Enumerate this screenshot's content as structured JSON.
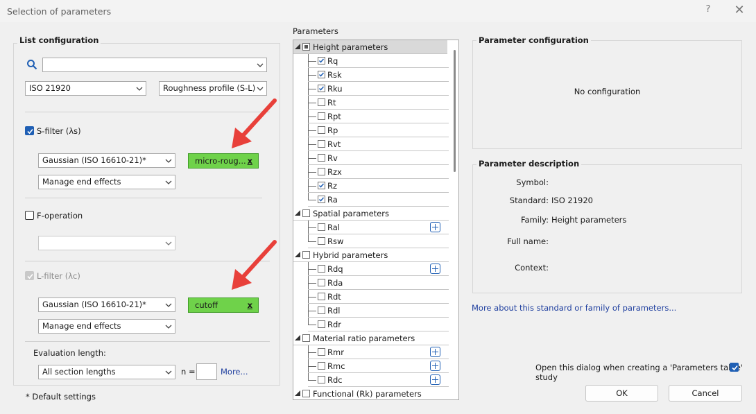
{
  "window": {
    "title": "Selection of parameters",
    "help": "?",
    "close": "✕"
  },
  "list_config": {
    "legend": "List configuration",
    "search": {
      "value": "",
      "placeholder": ""
    },
    "standard": "ISO 21920",
    "profile": "Roughness profile (S-L)",
    "s_filter": {
      "label": "S-filter (λs)",
      "checked": true,
      "type": "Gaussian (ISO 16610-21)*",
      "end_effects": "Manage end effects",
      "button": "micro-roug...",
      "button_x": "x"
    },
    "f_operation": {
      "label": "F-operation",
      "checked": false,
      "value": ""
    },
    "l_filter": {
      "label": "L-filter (λc)",
      "checked": true,
      "disabled": true,
      "type": "Gaussian (ISO 16610-21)*",
      "end_effects": "Manage end effects",
      "button": "cutoff",
      "button_x": "x"
    },
    "evaluation": {
      "label": "Evaluation length:",
      "value": "All section lengths",
      "n_label": "n =",
      "n_value": "",
      "more_link": "More..."
    }
  },
  "default_note": "* Default settings",
  "parameters": {
    "header": "Parameters",
    "groups": [
      {
        "name": "Height parameters",
        "state": "partial",
        "selected": true,
        "items": [
          {
            "name": "Rq",
            "checked": true,
            "plus": false
          },
          {
            "name": "Rsk",
            "checked": true,
            "plus": false
          },
          {
            "name": "Rku",
            "checked": true,
            "plus": false
          },
          {
            "name": "Rt",
            "checked": false,
            "plus": false
          },
          {
            "name": "Rpt",
            "checked": false,
            "plus": false
          },
          {
            "name": "Rp",
            "checked": false,
            "plus": false
          },
          {
            "name": "Rvt",
            "checked": false,
            "plus": false
          },
          {
            "name": "Rv",
            "checked": false,
            "plus": false
          },
          {
            "name": "Rzx",
            "checked": false,
            "plus": false
          },
          {
            "name": "Rz",
            "checked": true,
            "plus": false
          },
          {
            "name": "Ra",
            "checked": true,
            "plus": false
          }
        ]
      },
      {
        "name": "Spatial parameters",
        "state": "unchecked",
        "selected": false,
        "items": [
          {
            "name": "Ral",
            "checked": false,
            "plus": true
          },
          {
            "name": "Rsw",
            "checked": false,
            "plus": false
          }
        ]
      },
      {
        "name": "Hybrid parameters",
        "state": "unchecked",
        "selected": false,
        "items": [
          {
            "name": "Rdq",
            "checked": false,
            "plus": true
          },
          {
            "name": "Rda",
            "checked": false,
            "plus": false
          },
          {
            "name": "Rdt",
            "checked": false,
            "plus": false
          },
          {
            "name": "Rdl",
            "checked": false,
            "plus": false
          },
          {
            "name": "Rdr",
            "checked": false,
            "plus": false
          }
        ]
      },
      {
        "name": "Material ratio parameters",
        "state": "unchecked",
        "selected": false,
        "items": [
          {
            "name": "Rmr",
            "checked": false,
            "plus": true
          },
          {
            "name": "Rmc",
            "checked": false,
            "plus": true
          },
          {
            "name": "Rdc",
            "checked": false,
            "plus": true
          }
        ]
      },
      {
        "name": "Functional (Rk) parameters",
        "state": "unchecked",
        "selected": false,
        "items": []
      }
    ]
  },
  "param_config": {
    "legend": "Parameter configuration",
    "text": "No configuration"
  },
  "param_desc": {
    "legend": "Parameter description",
    "symbol_label": "Symbol:",
    "symbol": "",
    "standard_label": "Standard:",
    "standard": "ISO 21920",
    "family_label": "Family:",
    "family": "Height parameters",
    "fullname_label": "Full name:",
    "fullname": "",
    "context_label": "Context:",
    "context": ""
  },
  "more_link": "More about this standard or family of parameters...",
  "open_dialog": {
    "label": "Open this dialog when creating a 'Parameters table' study",
    "checked": true
  },
  "buttons": {
    "ok": "OK",
    "cancel": "Cancel"
  },
  "colors": {
    "accent": "#1f5fb4",
    "green_button": "#6fd24a",
    "arrow": "#e8403a",
    "link": "#1f3f9f"
  }
}
